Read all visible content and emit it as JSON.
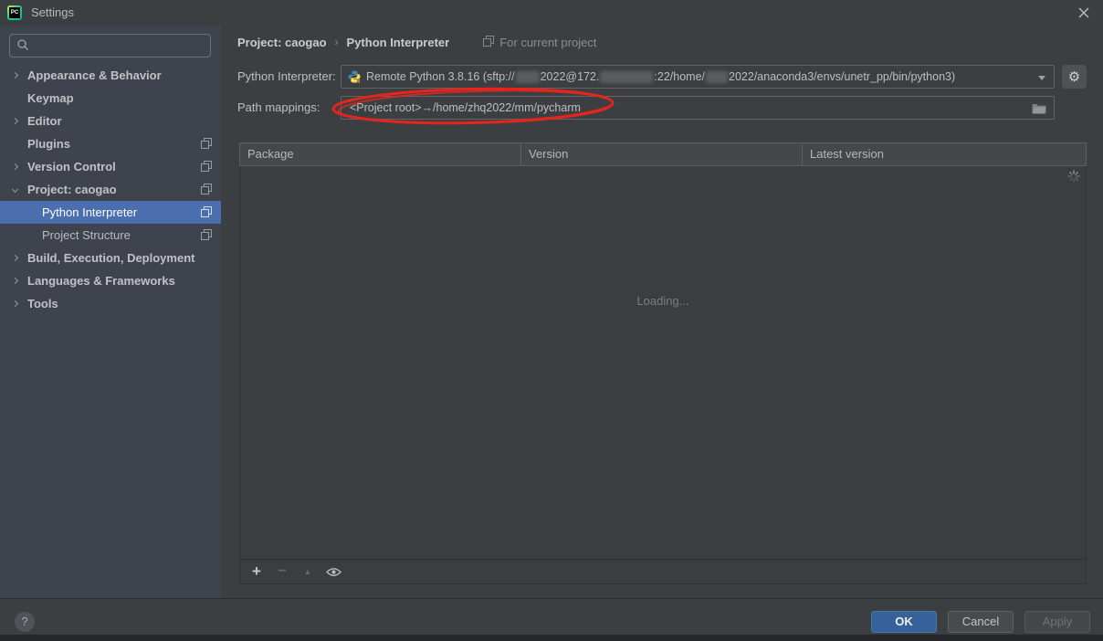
{
  "window": {
    "title": "Settings"
  },
  "sidebar": {
    "items": [
      "Appearance & Behavior",
      "Keymap",
      "Editor",
      "Plugins",
      "Version Control",
      "Project: caogao",
      "Python Interpreter",
      "Project Structure",
      "Build, Execution, Deployment",
      "Languages & Frameworks",
      "Tools"
    ]
  },
  "breadcrumb": {
    "project": "Project: caogao",
    "separator": "›",
    "page": "Python Interpreter",
    "scope": "For current project"
  },
  "interpreter": {
    "label": "Python Interpreter:",
    "seg1": "Remote Python 3.8.16 (sftp://",
    "seg2": "2022@172.",
    "seg3": ":22/home/",
    "seg4": "2022/anaconda3/envs/unetr_pp/bin/python3)"
  },
  "path_mappings": {
    "label": "Path mappings:",
    "value": "<Project root>→/home/zhq2022/mm/pycharm"
  },
  "packages_table": {
    "columns": [
      "Package",
      "Version",
      "Latest version"
    ],
    "status": "Loading..."
  },
  "icons": {
    "gear": "⚙",
    "add": "+",
    "remove": "−",
    "move_up": "▲"
  },
  "footer": {
    "help": "?",
    "ok": "OK",
    "cancel": "Cancel",
    "apply": "Apply"
  },
  "colors": {
    "selection_blue": "#4b6eaf",
    "ok_button_blue": "#366199",
    "annotation_red": "#e5251d",
    "sidebar_bg": "#3f434e",
    "panel_bg": "#3c3f41"
  }
}
